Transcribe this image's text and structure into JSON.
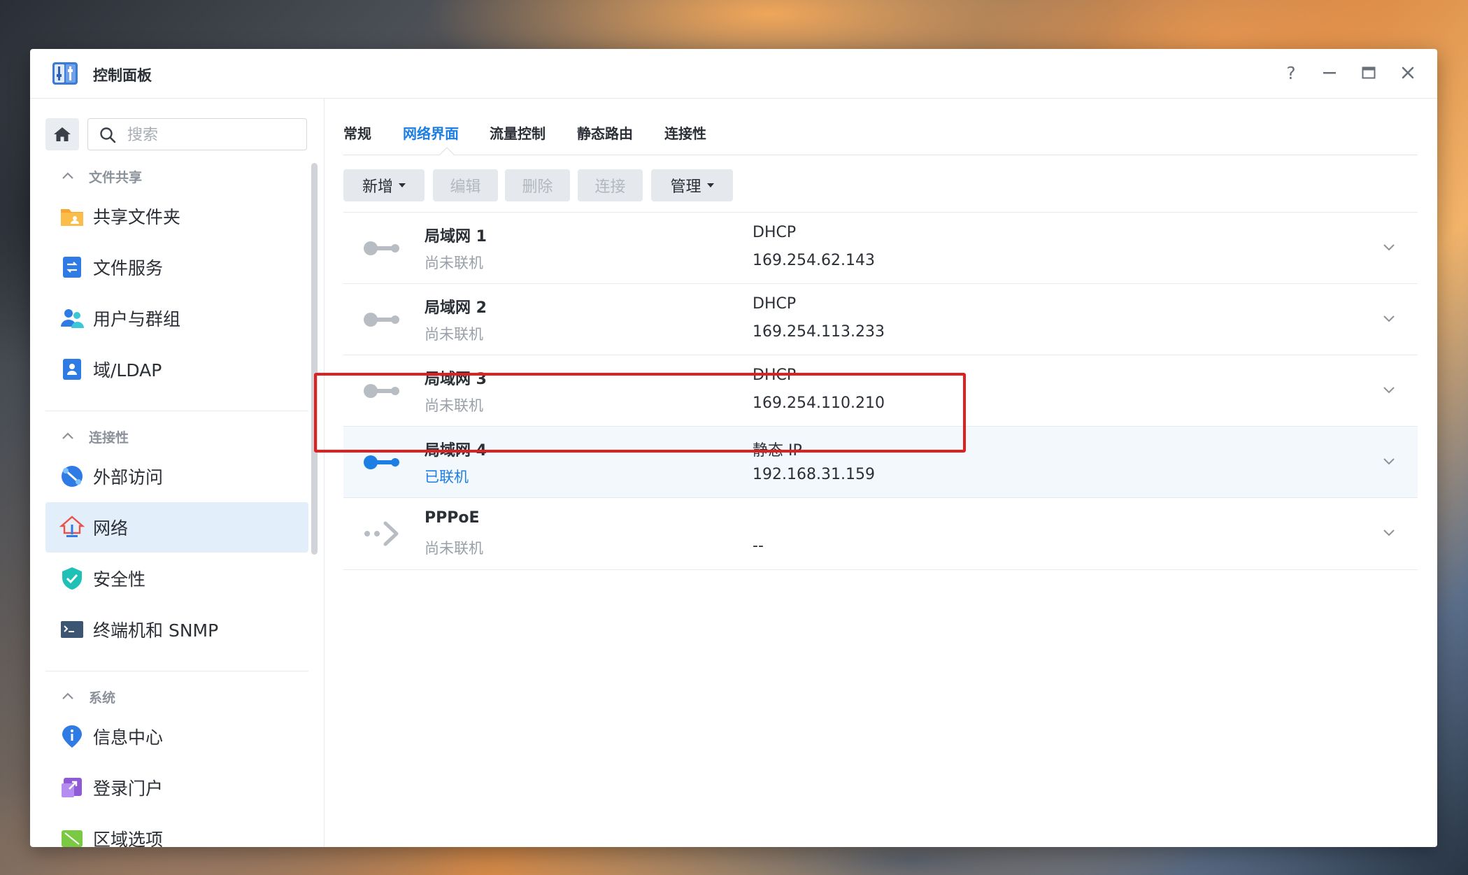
{
  "window": {
    "title": "控制面板",
    "icon": "control-panel-icon"
  },
  "window_controls": {
    "help": "?",
    "minimize": "—",
    "maximize": "□",
    "close": "✕"
  },
  "sidebar": {
    "search_placeholder": "搜索",
    "groups": [
      {
        "label": "文件共享",
        "items": [
          {
            "label": "共享文件夹",
            "icon": "shared-folder-icon"
          },
          {
            "label": "文件服务",
            "icon": "file-services-icon"
          },
          {
            "label": "用户与群组",
            "icon": "user-group-icon"
          },
          {
            "label": "域/LDAP",
            "icon": "domain-ldap-icon"
          }
        ]
      },
      {
        "label": "连接性",
        "items": [
          {
            "label": "外部访问",
            "icon": "external-access-icon"
          },
          {
            "label": "网络",
            "icon": "network-icon",
            "active": true
          },
          {
            "label": "安全性",
            "icon": "security-shield-icon"
          },
          {
            "label": "终端机和 SNMP",
            "icon": "terminal-icon"
          }
        ]
      },
      {
        "label": "系统",
        "items": [
          {
            "label": "信息中心",
            "icon": "info-center-icon"
          },
          {
            "label": "登录门户",
            "icon": "login-portal-icon"
          },
          {
            "label": "区域选项",
            "icon": "regional-options-icon"
          }
        ]
      }
    ]
  },
  "tabs": [
    {
      "label": "常规"
    },
    {
      "label": "网络界面",
      "active": true
    },
    {
      "label": "流量控制"
    },
    {
      "label": "静态路由"
    },
    {
      "label": "连接性"
    }
  ],
  "toolbar": {
    "create": "新增",
    "edit": "编辑",
    "delete": "删除",
    "connect": "连接",
    "manage": "管理"
  },
  "interfaces": [
    {
      "name": "局域网 1",
      "status": "尚未联机",
      "mode": "DHCP",
      "ip": "169.254.62.143",
      "connected": false
    },
    {
      "name": "局域网 2",
      "status": "尚未联机",
      "mode": "DHCP",
      "ip": "169.254.113.233",
      "connected": false
    },
    {
      "name": "局域网 3",
      "status": "尚未联机",
      "mode": "DHCP",
      "ip": "169.254.110.210",
      "connected": false
    },
    {
      "name": "局域网 4",
      "status": "已联机",
      "mode": "静态 IP",
      "ip": "192.168.31.159",
      "connected": true
    },
    {
      "name": "PPPoE",
      "status": "尚未联机",
      "mode": "",
      "ip": "--",
      "connected": false
    }
  ],
  "colors": {
    "accent": "#1d7ee3",
    "highlight_border": "#e02020",
    "muted": "#9aa0a8"
  }
}
